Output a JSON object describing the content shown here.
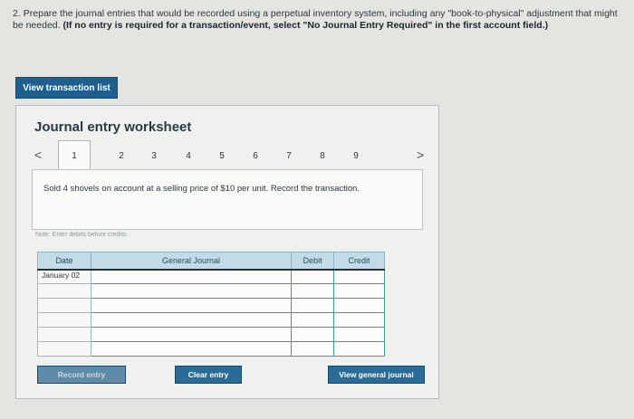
{
  "question": {
    "number": "2.",
    "text": "Prepare the journal entries that would be recorded using a perpetual inventory system, including any \"book-to-physical\" adjustment that might be needed.",
    "instruction": "(If no entry is required for a transaction/event, select \"No Journal Entry Required\" in the first account field.)"
  },
  "view_transaction_list": "View transaction list",
  "worksheet": {
    "title": "Journal entry worksheet",
    "prev_arrow": "<",
    "next_arrow": ">",
    "tabs": [
      "1",
      "2",
      "3",
      "4",
      "5",
      "6",
      "7",
      "8",
      "9"
    ],
    "active_tab": "1",
    "description": "Sold 4 shovels on account at a selling price of $10 per unit. Record the transaction.",
    "note": "Note: Enter debits before credits."
  },
  "journal_table": {
    "headers": {
      "date": "Date",
      "general_journal": "General Journal",
      "debit": "Debit",
      "credit": "Credit"
    },
    "date_value": "January 02"
  },
  "buttons": {
    "record_entry": "Record entry",
    "clear_entry": "Clear entry",
    "view_general_journal": "View general journal"
  },
  "colors": {
    "primary_button": "#2a6c96",
    "header_bg": "#c2dbe7",
    "input_border": "#3aa08c"
  }
}
